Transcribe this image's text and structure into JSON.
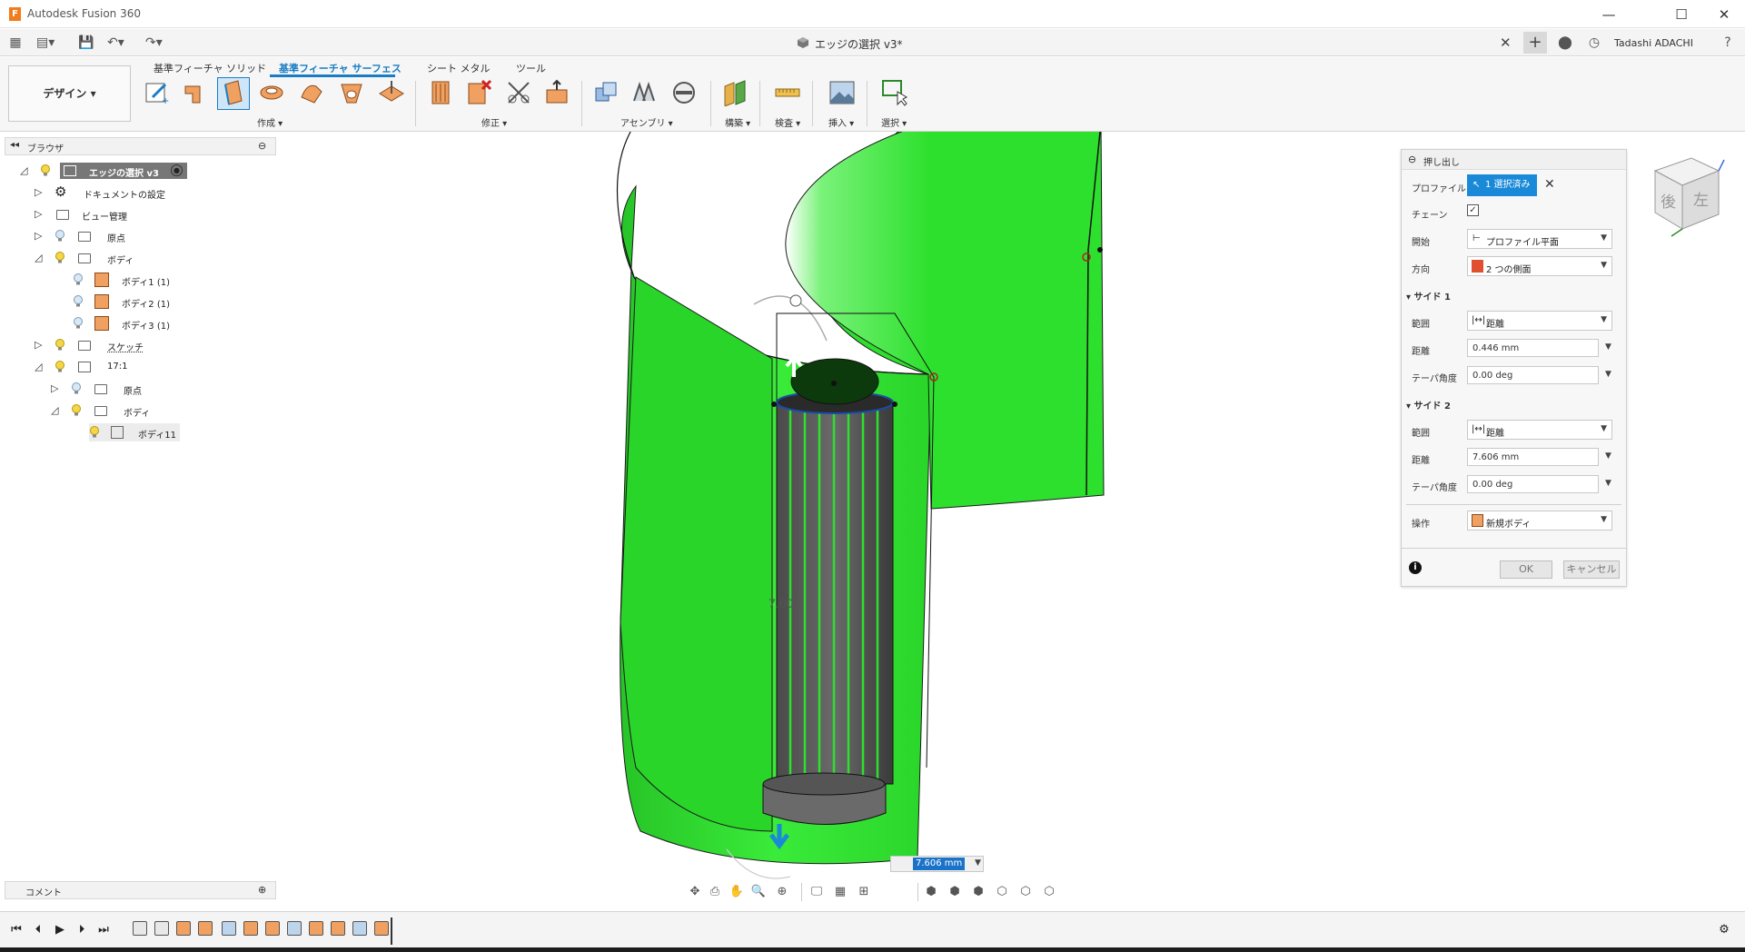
{
  "titlebar": {
    "app_title": "Autodesk Fusion 360",
    "app_icon_letter": "F"
  },
  "tabbar": {
    "doc_title": "エッジの選択 v3*",
    "user_name": "Tadashi ADACHI"
  },
  "toolbar": {
    "workspace_label": "デザイン ▾",
    "tabs": [
      "基準フィーチャ ソリッド",
      "基準フィーチャ サーフェス",
      "シート メタル",
      "ツール"
    ],
    "groups": [
      "作成 ▾",
      "修正 ▾",
      "アセンブリ ▾",
      "構築 ▾",
      "検査 ▾",
      "挿入 ▾",
      "選択 ▾"
    ]
  },
  "browser": {
    "title": "ブラウザ",
    "rows": [
      {
        "label": "エッジの選択 v3"
      },
      {
        "label": "ドキュメントの設定"
      },
      {
        "label": "ビュー管理"
      },
      {
        "label": "原点"
      },
      {
        "label": "ボディ"
      },
      {
        "label": "ボディ1 (1)"
      },
      {
        "label": "ボディ2 (1)"
      },
      {
        "label": "ボディ3 (1)"
      },
      {
        "label": "スケッチ"
      },
      {
        "label": "17:1"
      },
      {
        "label": "原点"
      },
      {
        "label": "ボディ"
      },
      {
        "label": "ボディ11"
      }
    ]
  },
  "comment_bar": {
    "label": "コメント"
  },
  "dialog": {
    "title": "押し出し",
    "profile_label": "プロファイル",
    "profile_value": "1 選択済み",
    "chain_label": "チェーン",
    "chain_checked": true,
    "start_label": "開始",
    "start_value": "プロファイル平面",
    "direction_label": "方向",
    "direction_value": "2 つの側面",
    "side1_title": "サイド 1",
    "side1": {
      "extent_label": "範囲",
      "extent_value": "距離",
      "distance_label": "距離",
      "distance_value": "0.446 mm",
      "taper_label": "テーパ角度",
      "taper_value": "0.00 deg"
    },
    "side2_title": "サイド 2",
    "side2": {
      "extent_label": "範囲",
      "extent_value": "距離",
      "distance_label": "距離",
      "distance_value": "7.606 mm",
      "taper_label": "テーパ角度",
      "taper_value": "0.00 deg"
    },
    "operation_label": "操作",
    "operation_value": "新規ボディ",
    "ok_label": "OK",
    "cancel_label": "キャンセル"
  },
  "viewport": {
    "distance_input": "7.606 mm",
    "dimension_label": "7.606",
    "body_color": "#2ee02e",
    "viewcube_labels": [
      "後",
      "左"
    ]
  }
}
